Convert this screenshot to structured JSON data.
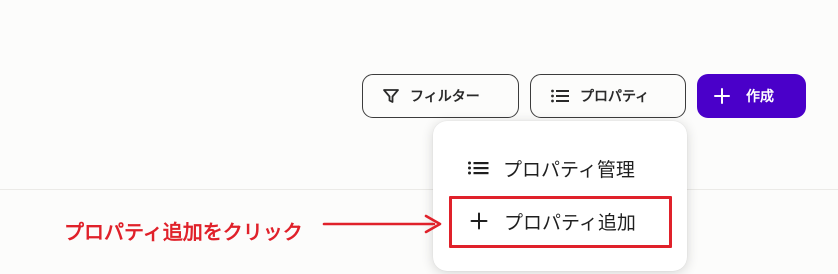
{
  "toolbar": {
    "filter_label": "フィルター",
    "properties_label": "プロパティ",
    "create_label": "作成"
  },
  "menu": {
    "items": [
      {
        "label": "プロパティ管理",
        "icon": "list-icon"
      },
      {
        "label": "プロパティ追加",
        "icon": "plus-icon"
      }
    ]
  },
  "annotation": {
    "text": "プロパティ追加をクリック",
    "color": "#e0212a"
  },
  "colors": {
    "accent": "#4a00c9",
    "highlight": "#e0212a"
  }
}
